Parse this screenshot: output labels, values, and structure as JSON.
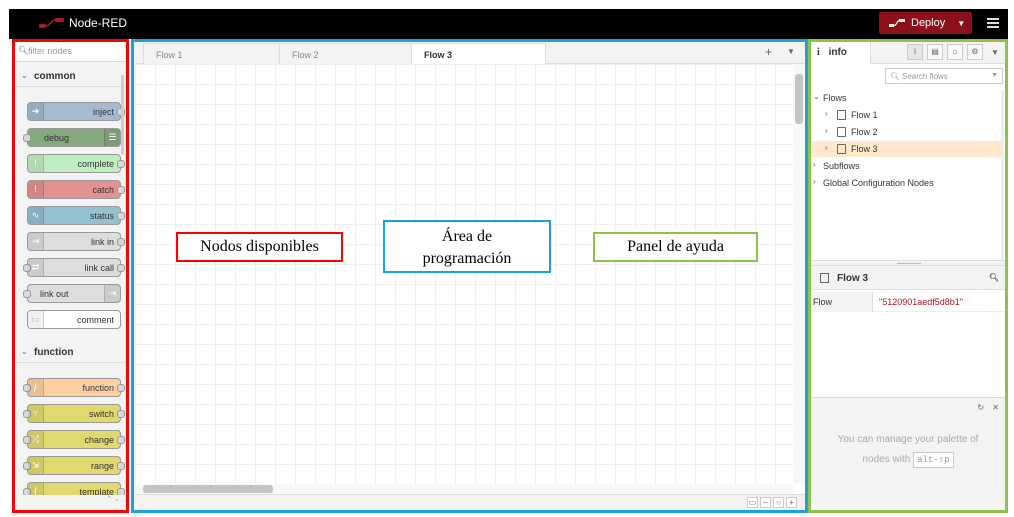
{
  "header": {
    "app_title": "Node-RED",
    "deploy_label": "Deploy",
    "colors": {
      "header_bg": "#000000",
      "deploy_bg": "#8c101c"
    }
  },
  "palette": {
    "search_placeholder": "filter nodes",
    "categories": [
      {
        "name": "common",
        "nodes": [
          {
            "label": "inject",
            "color": "#a6bbcf"
          },
          {
            "label": "debug",
            "color": "#87a980"
          },
          {
            "label": "complete",
            "color": "#c0edc0"
          },
          {
            "label": "catch",
            "color": "#e49191"
          },
          {
            "label": "status",
            "color": "#94c1d0"
          },
          {
            "label": "link in",
            "color": "#dddddd"
          },
          {
            "label": "link call",
            "color": "#dddddd"
          },
          {
            "label": "link out",
            "color": "#dddddd"
          },
          {
            "label": "comment",
            "color": "#ffffff"
          }
        ]
      },
      {
        "name": "function",
        "nodes": [
          {
            "label": "function",
            "color": "#fdd0a2"
          },
          {
            "label": "switch",
            "color": "#e2d96e"
          },
          {
            "label": "change",
            "color": "#e2d96e"
          },
          {
            "label": "range",
            "color": "#e2d96e"
          },
          {
            "label": "template",
            "color": "#e2d96e"
          }
        ]
      }
    ]
  },
  "workspace": {
    "tabs": [
      {
        "label": "Flow 1",
        "active": false
      },
      {
        "label": "Flow 2",
        "active": false
      },
      {
        "label": "Flow 3",
        "active": true
      }
    ]
  },
  "annotations": {
    "palette_label": "Nodos disponibles",
    "workspace_label_line1": "Área de",
    "workspace_label_line2": "programación",
    "sidebar_label": "Panel de ayuda",
    "colors": {
      "palette": "#ff0000",
      "workspace": "#1ba1e2",
      "sidebar": "#8bc34a"
    }
  },
  "sidebar": {
    "tab_label": "info",
    "search_placeholder": "Search flows",
    "tree": {
      "flows_label": "Flows",
      "flows": [
        "Flow 1",
        "Flow 2",
        "Flow 3"
      ],
      "selected": "Flow 3",
      "subflows_label": "Subflows",
      "global_config_label": "Global Configuration Nodes"
    },
    "detail": {
      "title": "Flow 3",
      "prop_key": "Flow",
      "prop_value": "\"5120901aedf5d8b1\""
    },
    "tip": {
      "text_line1": "You can manage your palette of",
      "text_line2_prefix": "nodes with",
      "shortcut": "alt-⇧p"
    }
  }
}
